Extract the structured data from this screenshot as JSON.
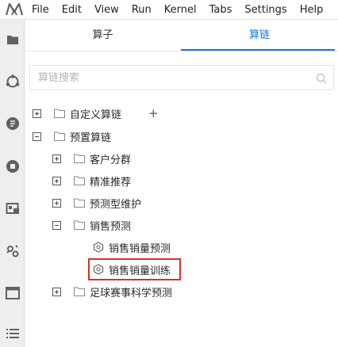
{
  "menubar": {
    "logo": "jupyter-logo",
    "items": [
      "File",
      "Edit",
      "View",
      "Run",
      "Kernel",
      "Tabs",
      "Settings",
      "Help"
    ]
  },
  "leftbar": {
    "icons": [
      "folder-icon",
      "running-icon",
      "commands-icon",
      "stop-icon",
      "package-icon",
      "extension-icon",
      "window-icon",
      "list-icon"
    ]
  },
  "tabs": {
    "left_label": "算子",
    "right_label": "算链",
    "active": "right"
  },
  "search": {
    "placeholder": "算链搜索",
    "value": ""
  },
  "tree": {
    "custom": {
      "label": "自定义算链",
      "add": "+"
    },
    "preset": {
      "label": "预置算链"
    },
    "customer_segmentation": {
      "label": "客户分群"
    },
    "precise_recommendation": {
      "label": "精准推荐"
    },
    "predictive_maintenance": {
      "label": "预测型维护"
    },
    "sales_forecast": {
      "label": "销售预测"
    },
    "sales_volume_forecast": {
      "label": "销售销量预测"
    },
    "sales_volume_training": {
      "label": "销售销量训练",
      "selected": true
    },
    "football_prediction": {
      "label": "足球赛事科学预测"
    }
  },
  "colors": {
    "accent": "#1a73d9",
    "highlight_border": "#d93025"
  }
}
